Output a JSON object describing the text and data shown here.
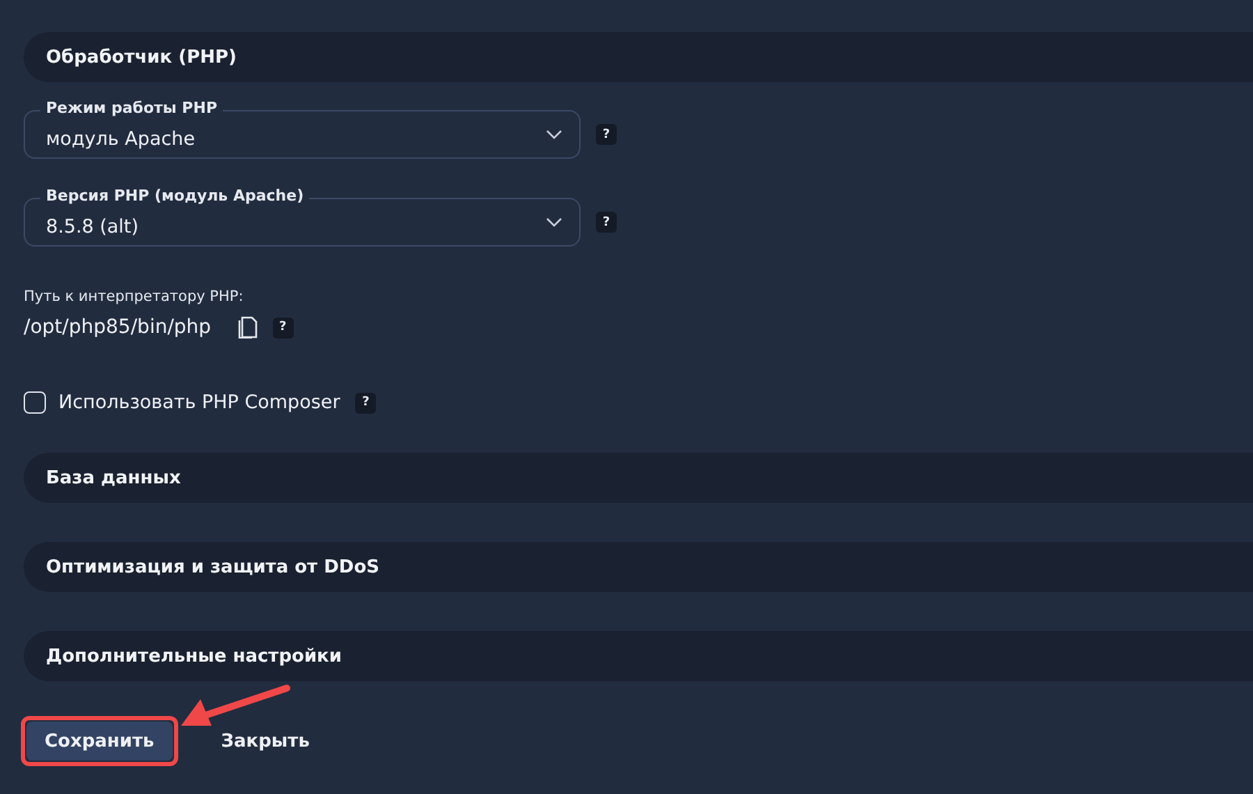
{
  "sections": [
    {
      "title": "Обработчик (PHP)"
    }
  ],
  "selects": [
    {
      "label": "Режим работы PHP",
      "value": "модуль Apache",
      "help": "?"
    },
    {
      "label": "Версия PHP (модуль Apache)",
      "value": "8.5.8 (alt)",
      "help": "?"
    }
  ],
  "interpreter": {
    "label": "Путь к интерпретатору PHP:",
    "value": "/opt/php85/bin/php",
    "help": "?"
  },
  "composer": {
    "label": "Использовать PHP Composer",
    "checked": false,
    "help": "?"
  },
  "collapsed_sections": [
    {
      "title": "База данных"
    },
    {
      "title": "Оптимизация и защита от DDoS"
    },
    {
      "title": "Дополнительные настройки"
    }
  ],
  "buttons": [
    {
      "label": "Сохранить",
      "kind": "primary",
      "highlighted": true
    },
    {
      "label": "Закрыть",
      "kind": "plain",
      "highlighted": false
    }
  ]
}
